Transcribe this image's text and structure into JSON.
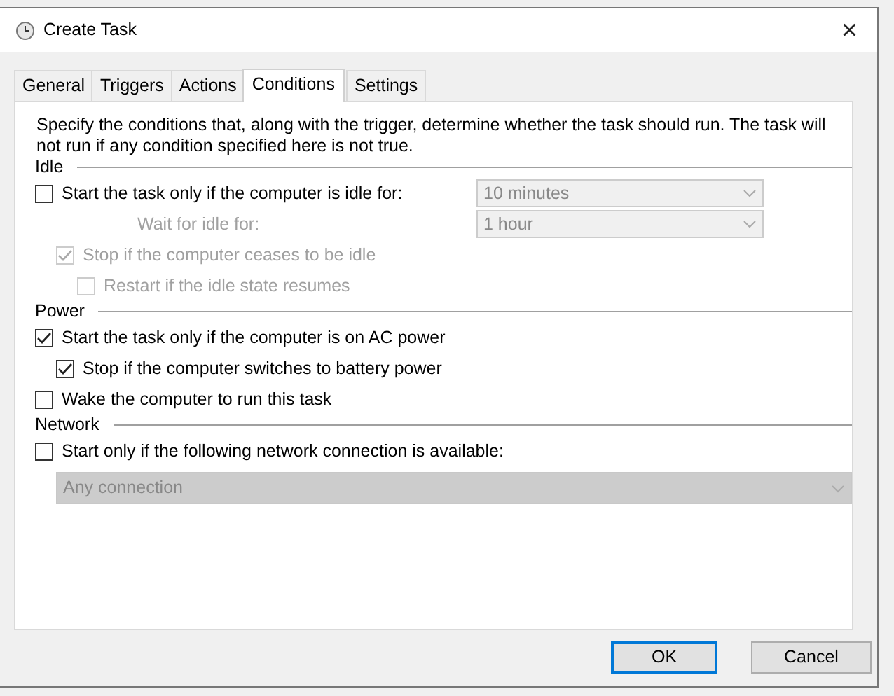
{
  "window": {
    "title": "Create Task",
    "close": "×"
  },
  "tabs": [
    {
      "label": "General",
      "selected": false
    },
    {
      "label": "Triggers",
      "selected": false
    },
    {
      "label": "Actions",
      "selected": false
    },
    {
      "label": "Conditions",
      "selected": true
    },
    {
      "label": "Settings",
      "selected": false
    }
  ],
  "description": "Specify the conditions that, along with the trigger, determine whether the task should run.  The task will not run  if any condition specified here is not true.",
  "sections": [
    {
      "title": "Idle",
      "items": [
        {
          "kind": "checkbox",
          "label": "Start the task only if the computer is idle for:",
          "checked": false,
          "disabled": false,
          "dropdown": {
            "value": "10 minutes",
            "disabled": true
          },
          "children": [
            {
              "kind": "field",
              "label": "Wait for idle for:",
              "disabled": true,
              "dropdown": {
                "value": "1 hour",
                "disabled": true
              }
            },
            {
              "kind": "checkbox",
              "label": "Stop if the computer ceases to be idle",
              "checked": true,
              "disabled": true,
              "children": [
                {
                  "kind": "checkbox",
                  "label": "Restart if the idle state resumes",
                  "checked": false,
                  "disabled": true
                }
              ]
            }
          ]
        }
      ]
    },
    {
      "title": "Power",
      "items": [
        {
          "kind": "checkbox",
          "label": "Start the task only if the computer is on AC power",
          "checked": true,
          "disabled": false,
          "children": [
            {
              "kind": "checkbox",
              "label": "Stop if the computer switches to battery power",
              "checked": true,
              "disabled": false
            }
          ]
        },
        {
          "kind": "checkbox",
          "label": "Wake the computer to run this task",
          "checked": false,
          "disabled": false
        }
      ]
    },
    {
      "title": "Network",
      "items": [
        {
          "kind": "checkbox",
          "label": "Start only if the following network connection is available:",
          "checked": false,
          "disabled": false
        },
        {
          "kind": "select",
          "value": "Any connection",
          "disabled": true
        }
      ]
    }
  ],
  "buttons": [
    {
      "label": "OK",
      "default": true
    },
    {
      "label": "Cancel",
      "default": false
    }
  ]
}
